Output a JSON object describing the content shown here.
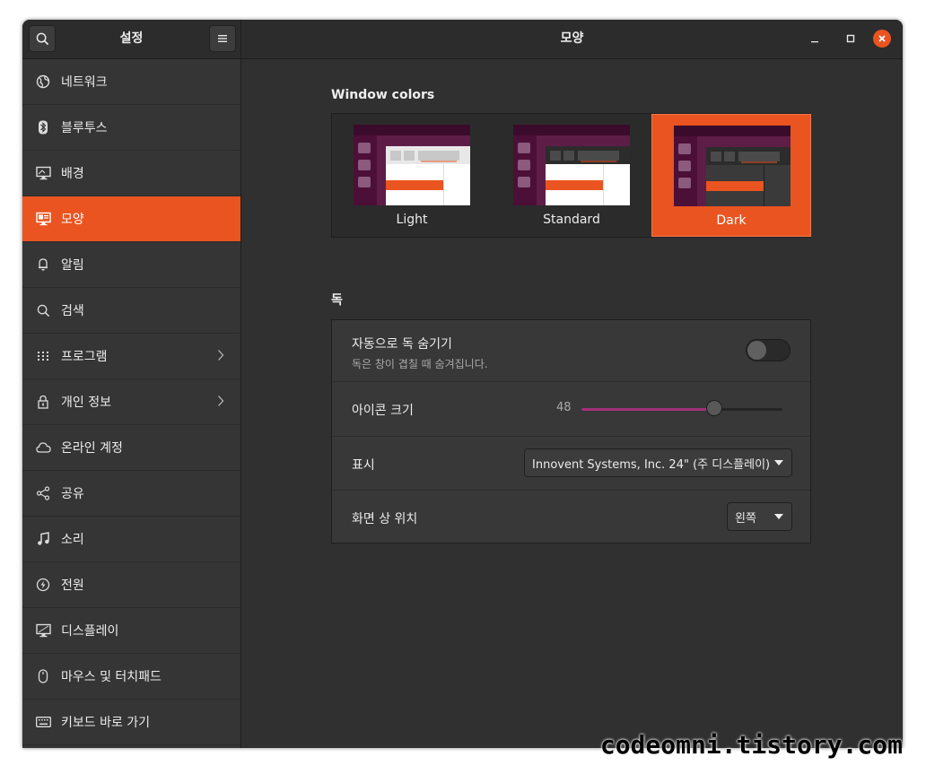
{
  "header": {
    "sidebar_title": "설정",
    "page_title": "모양"
  },
  "sidebar": {
    "items": [
      {
        "label": "네트워크",
        "icon": "globe-icon"
      },
      {
        "label": "블루투스",
        "icon": "bluetooth-icon"
      },
      {
        "label": "배경",
        "icon": "monitor-icon"
      },
      {
        "label": "모양",
        "icon": "appearance-icon",
        "active": true
      },
      {
        "label": "알림",
        "icon": "bell-icon"
      },
      {
        "label": "검색",
        "icon": "search-icon"
      },
      {
        "label": "프로그램",
        "icon": "apps-grid-icon",
        "chevron": true
      },
      {
        "label": "개인 정보",
        "icon": "lock-icon",
        "chevron": true
      },
      {
        "label": "온라인 계정",
        "icon": "cloud-icon"
      },
      {
        "label": "공유",
        "icon": "share-icon"
      },
      {
        "label": "소리",
        "icon": "music-note-icon"
      },
      {
        "label": "전원",
        "icon": "power-icon"
      },
      {
        "label": "디스플레이",
        "icon": "display-icon"
      },
      {
        "label": "마우스 및 터치패드",
        "icon": "mouse-icon"
      },
      {
        "label": "키보드 바로 가기",
        "icon": "keyboard-icon"
      }
    ]
  },
  "window_colors": {
    "title": "Window colors",
    "options": [
      {
        "label": "Light",
        "selected": false
      },
      {
        "label": "Standard",
        "selected": false
      },
      {
        "label": "Dark",
        "selected": true
      }
    ]
  },
  "dock": {
    "title": "독",
    "autohide": {
      "label": "자동으로 독 숨기기",
      "description": "독은 창이 겹칠 때 숨겨집니다.",
      "enabled": false
    },
    "icon_size": {
      "label": "아이콘 크기",
      "value": "48",
      "fraction": 0.66
    },
    "display": {
      "label": "표시",
      "selected": "Innovent Systems, Inc. 24\" (주 디스플레이)"
    },
    "position": {
      "label": "화면 상 위치",
      "selected": "왼쪽"
    }
  },
  "colors": {
    "accent": "#e95420",
    "slider_fill": "#a2307a"
  },
  "watermark": "codeomni.tistory.com"
}
